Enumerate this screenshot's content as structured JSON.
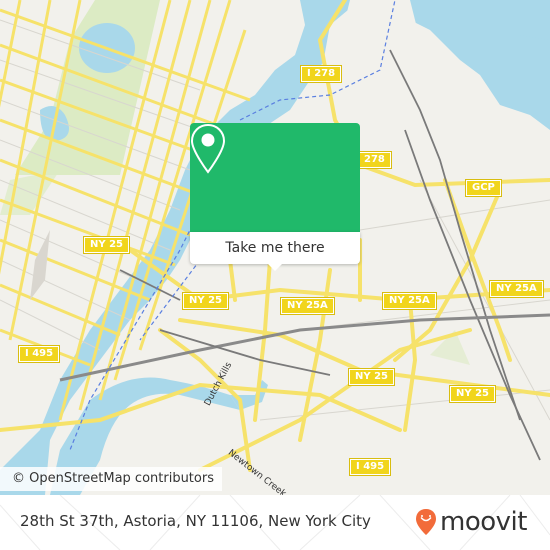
{
  "map": {
    "attribution": "© OpenStreetMap contributors",
    "colors": {
      "land": "#f2f1ec",
      "water": "#a9d8ea",
      "park": "#dcebc4",
      "road": "#f6e26a",
      "road_casing": "#e3c94a",
      "rail": "#7a7a7a",
      "minor": "#cfcfcf",
      "ferry": "#5a7fe0"
    },
    "shields": [
      {
        "label": "I 278"
      },
      {
        "label": "278"
      },
      {
        "label": "GCP"
      },
      {
        "label": "NY 25"
      },
      {
        "label": "NY 25"
      },
      {
        "label": "NY 25A"
      },
      {
        "label": "NY 25A"
      },
      {
        "label": "NY 25A"
      },
      {
        "label": "NY 25"
      },
      {
        "label": "NY 25"
      },
      {
        "label": "I 495"
      },
      {
        "label": "I 495"
      }
    ],
    "water_labels": [
      {
        "label": "Dutch Kills"
      },
      {
        "label": "Newtown Creek"
      }
    ]
  },
  "popup": {
    "icon": "location-pin-icon",
    "button_label": "Take me there",
    "color": "#20b96a"
  },
  "footer": {
    "address": "28th St 37th, Astoria, NY 11106, New York City",
    "logo_text": "moovit",
    "logo_icon": "moovit-pin-icon",
    "logo_color": "#f26b3a"
  }
}
